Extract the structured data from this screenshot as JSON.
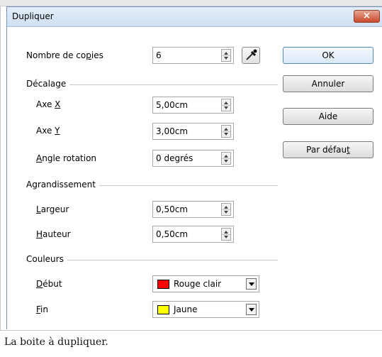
{
  "dialog": {
    "title": "Dupliquer",
    "close_glyph": "×",
    "copies": {
      "label": "Nombre de copies",
      "value": "6"
    },
    "decalage": {
      "heading": "Décalage",
      "axe_x": {
        "label_pre": "Axe ",
        "label_key": "X",
        "value": "5,00cm"
      },
      "axe_y": {
        "label_pre": "Axe ",
        "label_key": "Y",
        "value": "3,00cm"
      },
      "angle": {
        "label_key": "A",
        "label_post": "ngle rotation",
        "value": "0 degrés"
      }
    },
    "agrandissement": {
      "heading": "Agrandissement",
      "largeur": {
        "label_key": "L",
        "label_post": "argeur",
        "value": "0,50cm"
      },
      "hauteur": {
        "label_key": "H",
        "label_post": "auteur",
        "value": "0,50cm"
      }
    },
    "couleurs": {
      "heading": "Couleurs",
      "debut": {
        "label_key": "D",
        "label_post": "ébut",
        "value": "Rouge clair",
        "swatch_color": "#ff0000"
      },
      "fin": {
        "label_key": "F",
        "label_post": "in",
        "value": "Jaune",
        "swatch_color": "#ffff00"
      }
    },
    "buttons": {
      "ok": "OK",
      "annuler": "Annuler",
      "aide": "Aide",
      "par_defaut_pre": "Par défau",
      "par_defaut_key": "t"
    },
    "icons": {
      "picker": "eyedropper-icon",
      "close": "close-icon"
    }
  },
  "caption": "La boite à dupliquer."
}
